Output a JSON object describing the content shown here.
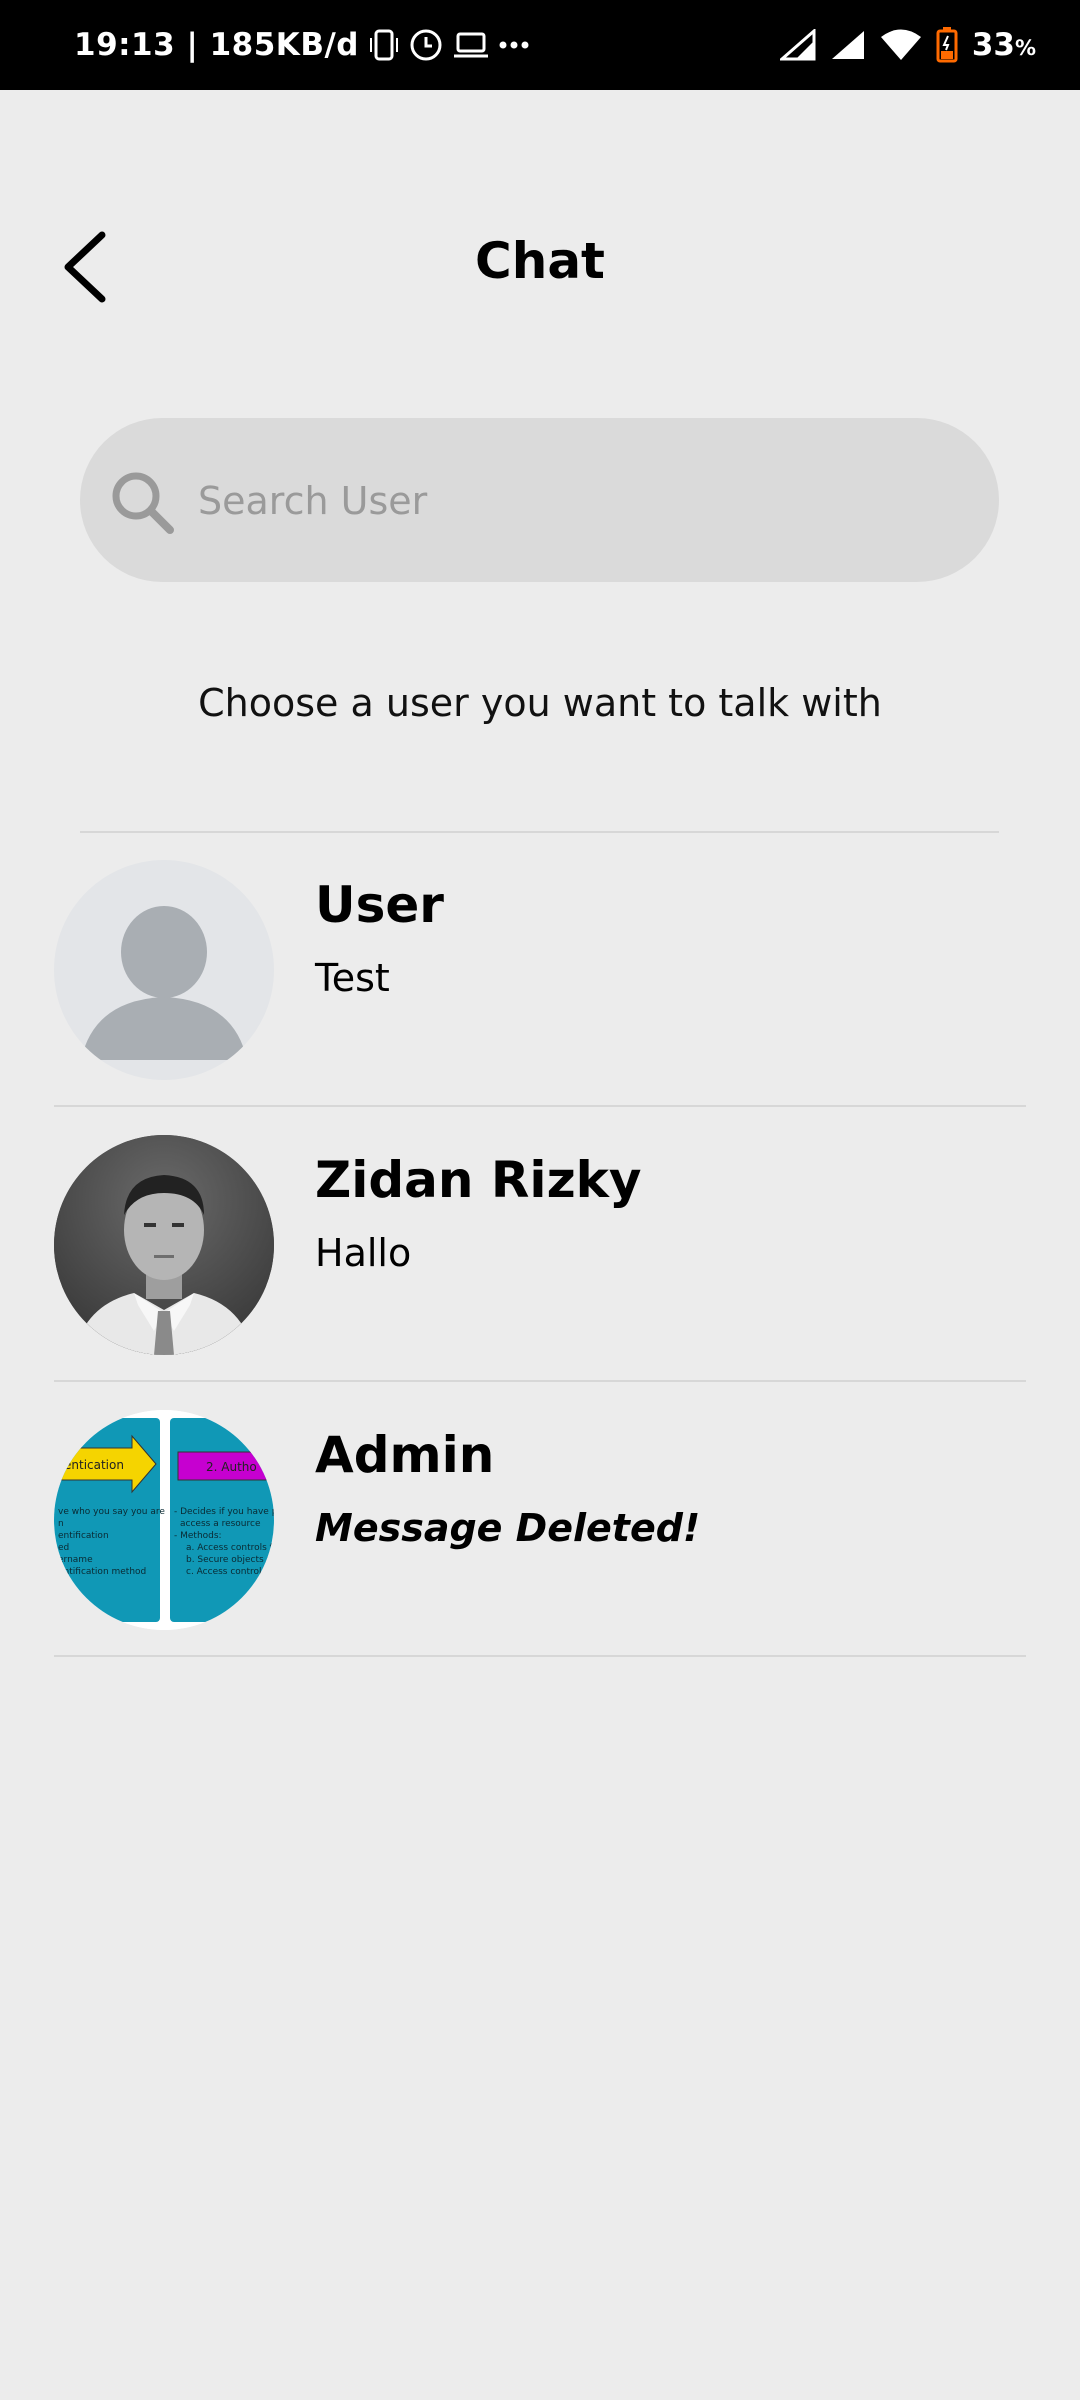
{
  "status_bar": {
    "time_and_speed": "19:13 | 185KB/d",
    "battery_percent": "33",
    "battery_unit": "%"
  },
  "header": {
    "title": "Chat",
    "back_icon": "chevron-left-icon"
  },
  "search": {
    "placeholder": "Search User",
    "value": "",
    "icon": "search-icon"
  },
  "hint": "Choose a user you want to talk with",
  "users": [
    {
      "name": "User",
      "last_message": "Test",
      "message_deleted": false,
      "avatar": "default-avatar"
    },
    {
      "name": "Zidan Rizky",
      "last_message": "Hallo",
      "message_deleted": false,
      "avatar": "photo-avatar"
    },
    {
      "name": "Admin",
      "last_message": "Message Deleted!",
      "message_deleted": true,
      "avatar": "image-avatar"
    }
  ],
  "avatar_image_text": {
    "left_banner": "entication",
    "right_banner": "2. Autho",
    "left_lines": [
      "ve who you say you are",
      "n",
      "entification",
      "ed",
      "ername",
      "entification method"
    ],
    "right_lines": [
      "- Decides if you have pe",
      "access a resource",
      "- Methods:",
      "a. Access controls fo",
      "b. Secure objects a",
      "c. Access control"
    ]
  },
  "colors": {
    "background": "#ececec",
    "search_background": "#dadada",
    "status_bar": "#000000",
    "divider": "#d7d7d7",
    "battery_accent": "#ff6a00"
  }
}
